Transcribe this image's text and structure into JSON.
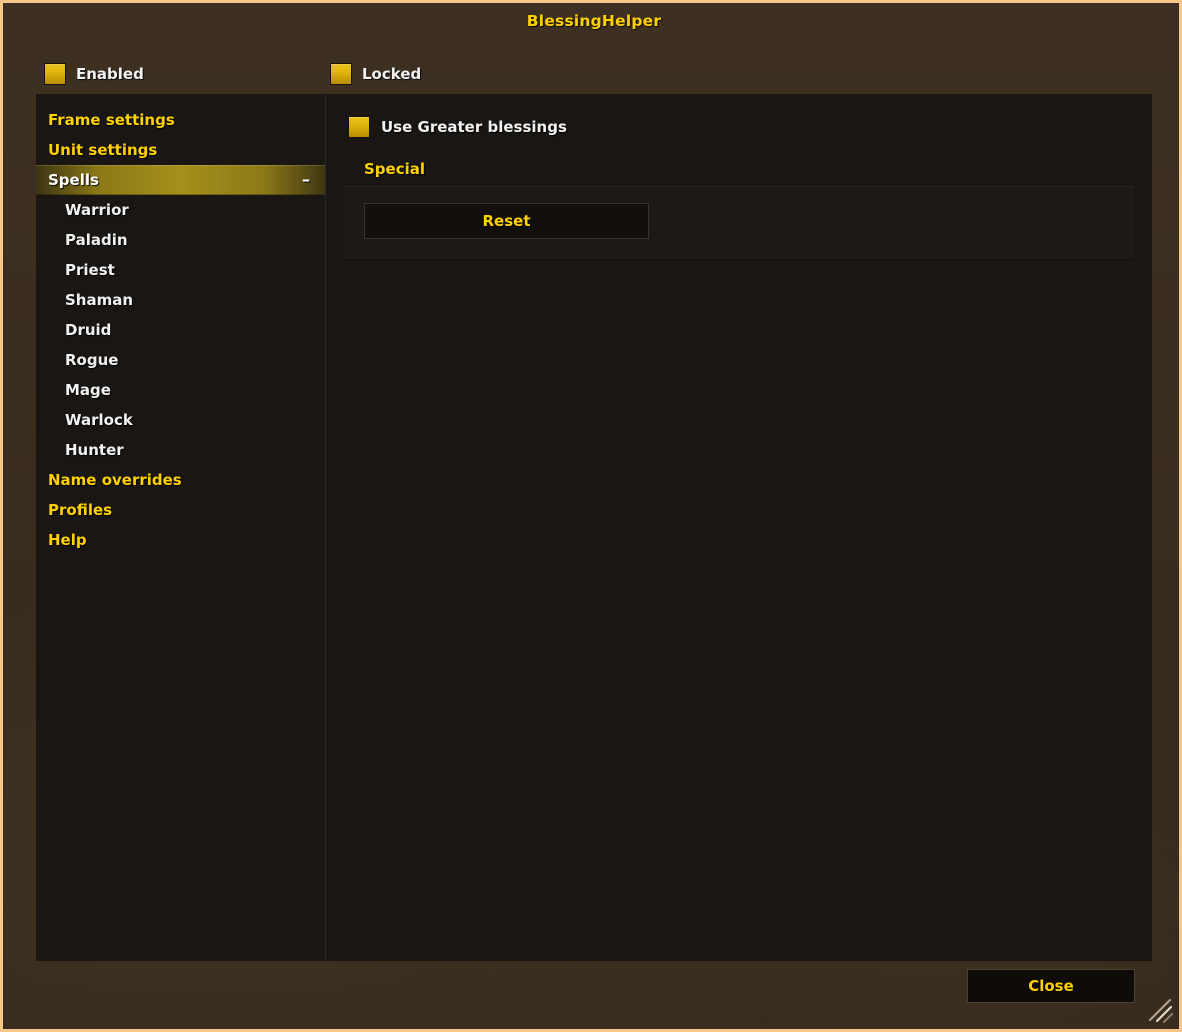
{
  "window": {
    "title": "BlessingHelper",
    "border_color": "#f7c689",
    "frame_color": "#3b2e1f",
    "panel_color": "#191613",
    "accent_gold": "#ffd100"
  },
  "top_toggles": [
    {
      "label": "Enabled",
      "checked": true,
      "icon": "checkbox-filled-icon"
    },
    {
      "label": "Locked",
      "checked": true,
      "icon": "checkbox-filled-icon"
    }
  ],
  "sidebar": {
    "items": [
      {
        "label": "Frame settings",
        "level": 0,
        "selected": false,
        "toggle": ""
      },
      {
        "label": "Unit settings",
        "level": 0,
        "selected": false,
        "toggle": ""
      },
      {
        "label": "Spells",
        "level": 0,
        "selected": true,
        "toggle": "–"
      },
      {
        "label": "Warrior",
        "level": 1,
        "selected": false,
        "toggle": ""
      },
      {
        "label": "Paladin",
        "level": 1,
        "selected": false,
        "toggle": ""
      },
      {
        "label": "Priest",
        "level": 1,
        "selected": false,
        "toggle": ""
      },
      {
        "label": "Shaman",
        "level": 1,
        "selected": false,
        "toggle": ""
      },
      {
        "label": "Druid",
        "level": 1,
        "selected": false,
        "toggle": ""
      },
      {
        "label": "Rogue",
        "level": 1,
        "selected": false,
        "toggle": ""
      },
      {
        "label": "Mage",
        "level": 1,
        "selected": false,
        "toggle": ""
      },
      {
        "label": "Warlock",
        "level": 1,
        "selected": false,
        "toggle": ""
      },
      {
        "label": "Hunter",
        "level": 1,
        "selected": false,
        "toggle": ""
      },
      {
        "label": "Name overrides",
        "level": 0,
        "selected": false,
        "toggle": ""
      },
      {
        "label": "Profiles",
        "level": 0,
        "selected": false,
        "toggle": ""
      },
      {
        "label": "Help",
        "level": 0,
        "selected": false,
        "toggle": ""
      }
    ]
  },
  "content": {
    "greater_blessings": {
      "label": "Use Greater blessings",
      "checked": true,
      "icon": "checkbox-filled-icon"
    },
    "special_group": {
      "heading": "Special",
      "reset_label": "Reset"
    }
  },
  "footer": {
    "close_label": "Close",
    "resize_grip_icon": "resize-grip-icon"
  }
}
